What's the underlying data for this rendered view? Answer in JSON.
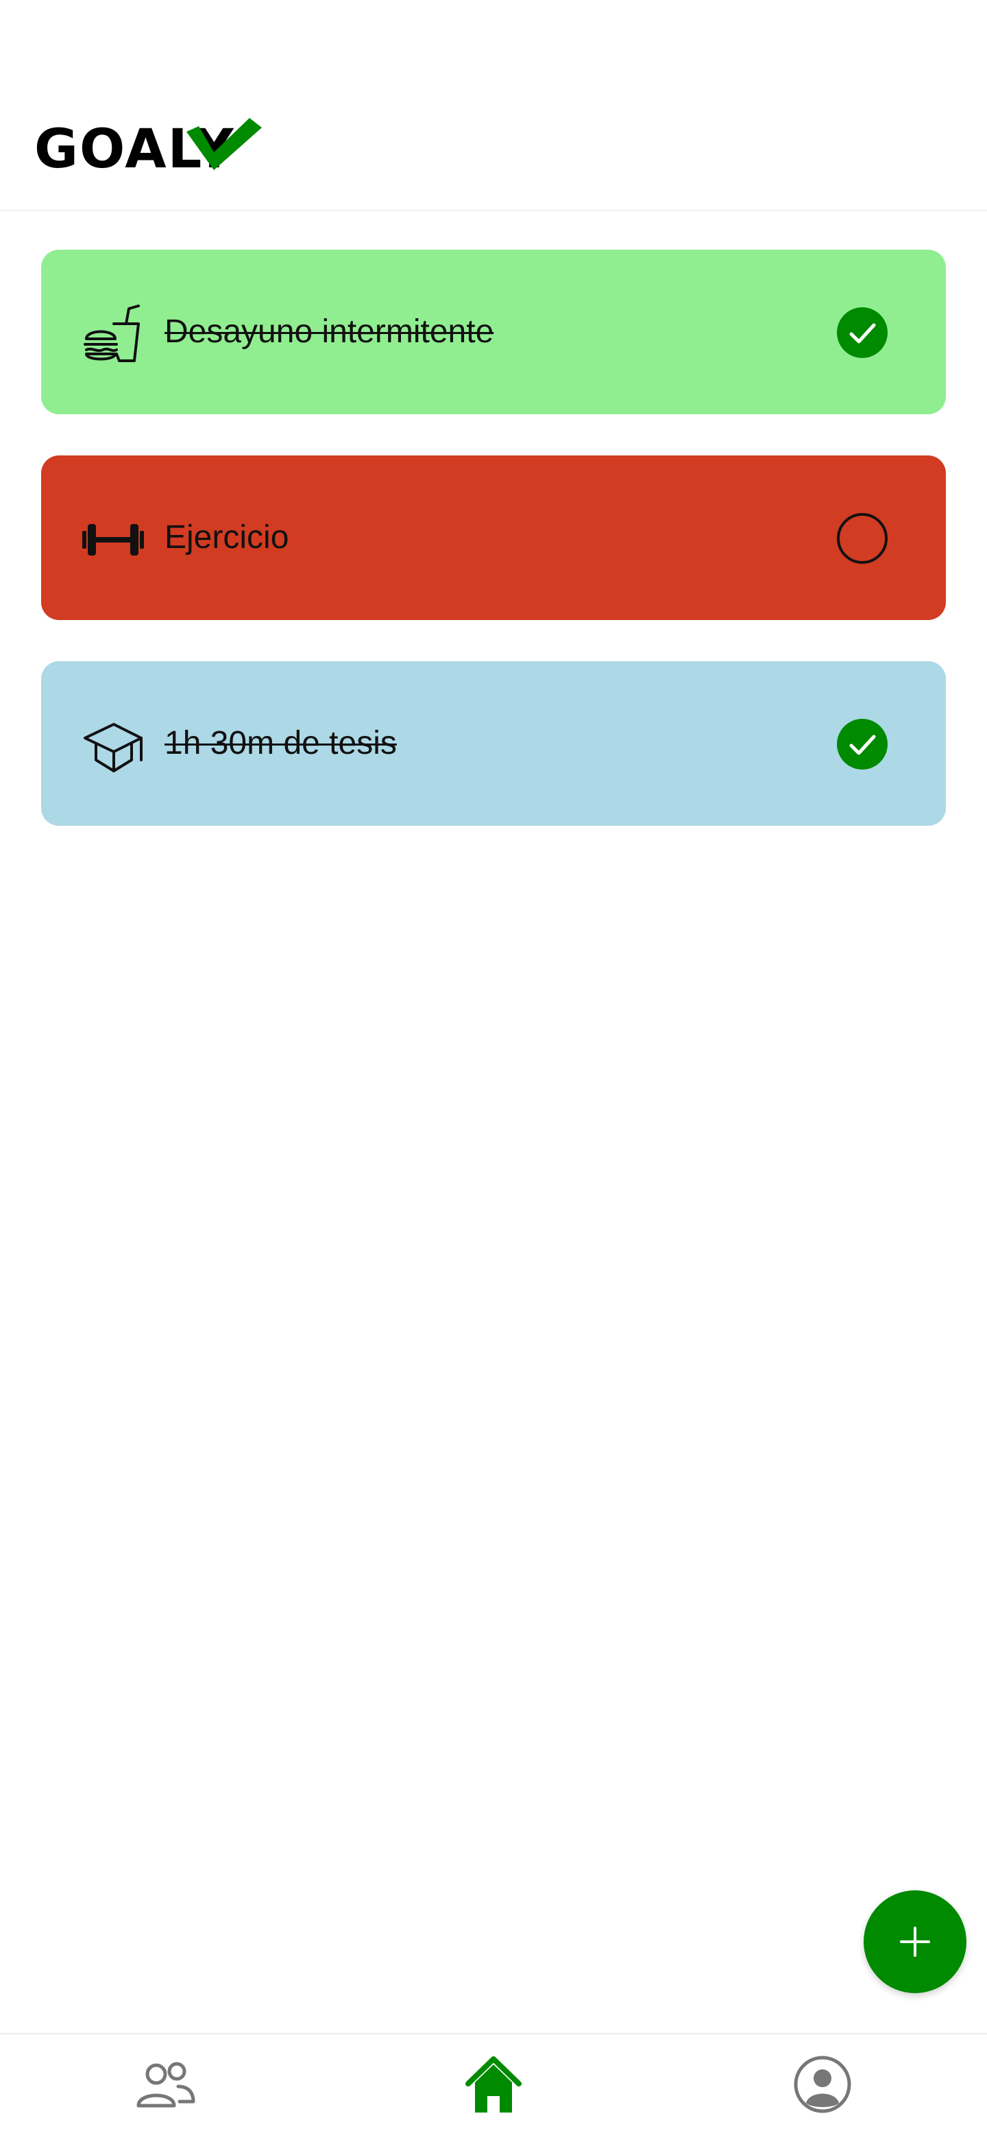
{
  "app": {
    "logo_text": "GOALY",
    "brand_color": "#008a00"
  },
  "tasks": [
    {
      "label": "Desayuno intermitente",
      "icon": "food-icon",
      "background": "#90ee90",
      "completed": true,
      "status_icon": "check-circle-icon"
    },
    {
      "label": "Ejercicio",
      "icon": "dumbbell-icon",
      "background": "#d23c22",
      "completed": false,
      "status_icon": "empty-circle-icon"
    },
    {
      "label": "1h 30m de tesis",
      "icon": "graduation-cap-icon",
      "background": "#add8e6",
      "completed": true,
      "status_icon": "check-circle-icon"
    }
  ],
  "fab": {
    "icon": "plus-icon"
  },
  "bottom_nav": {
    "items": [
      {
        "icon": "people-icon",
        "active": false,
        "color": "#777777"
      },
      {
        "icon": "home-icon",
        "active": true,
        "color": "#008a00"
      },
      {
        "icon": "profile-icon",
        "active": false,
        "color": "#777777"
      }
    ]
  }
}
